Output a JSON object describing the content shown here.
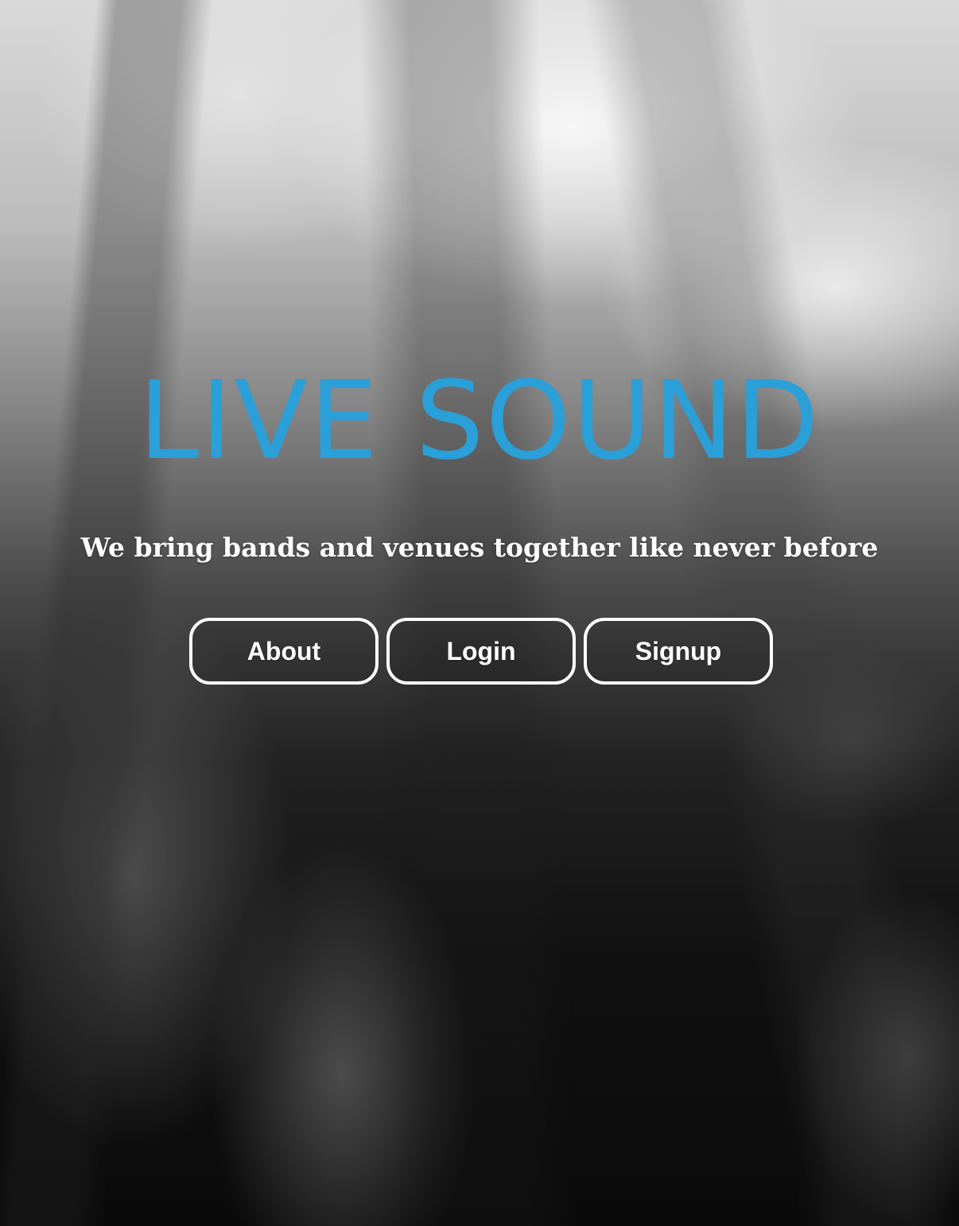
{
  "hero": {
    "title": "LIVE SOUND",
    "tagline": "We bring bands and venues together like never before",
    "title_color": "#2a9fd8",
    "background": "black-and-white blurred concert crowd photo"
  },
  "nav": {
    "about_label": "About",
    "login_label": "Login",
    "signup_label": "Signup"
  }
}
